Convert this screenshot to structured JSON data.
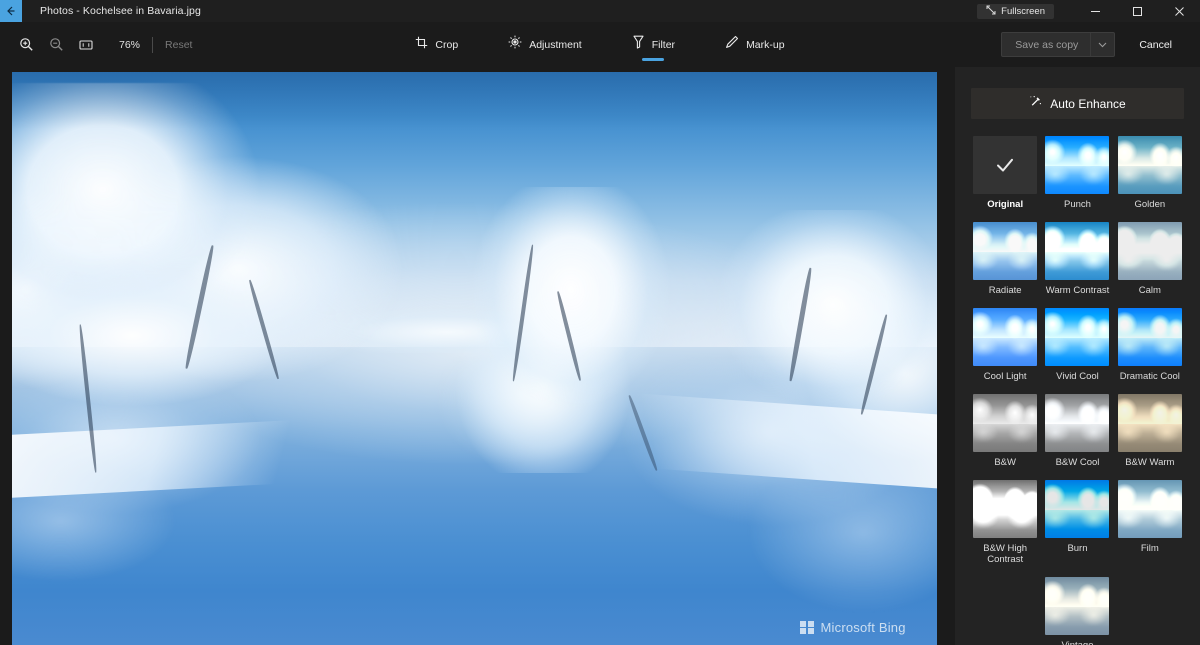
{
  "titlebar": {
    "back_icon": "back-arrow-icon",
    "title": "Photos - Kochelsee in Bavaria.jpg",
    "fullscreen_label": "Fullscreen",
    "fullscreen_icon": "expand-icon",
    "minimize_icon": "minimize-icon",
    "maximize_icon": "maximize-icon",
    "close_icon": "close-icon"
  },
  "toolbar": {
    "zoom_in_icon": "zoom-in-icon",
    "zoom_out_icon": "zoom-out-icon",
    "fit_to_window_icon": "fit-to-window-icon",
    "zoom_level": "76%",
    "reset_label": "Reset",
    "tabs": [
      {
        "label": "Crop",
        "icon": "crop-icon",
        "active": false
      },
      {
        "label": "Adjustment",
        "icon": "brightness-icon",
        "active": false
      },
      {
        "label": "Filter",
        "icon": "filter-icon",
        "active": true
      },
      {
        "label": "Mark-up",
        "icon": "pen-icon",
        "active": false
      }
    ],
    "save_as_copy_label": "Save as copy",
    "save_chevron_icon": "chevron-down-icon",
    "cancel_label": "Cancel"
  },
  "canvas": {
    "watermark_text": "Microsoft Bing",
    "watermark_logo": "microsoft-logo-icon"
  },
  "panel": {
    "auto_enhance_label": "Auto Enhance",
    "auto_enhance_icon": "magic-wand-icon",
    "selected_filter": "Original",
    "filters": [
      {
        "label": "Original",
        "fx": "original",
        "selected": true
      },
      {
        "label": "Punch",
        "fx": "fx-punch",
        "selected": false
      },
      {
        "label": "Golden",
        "fx": "fx-golden",
        "selected": false
      },
      {
        "label": "Radiate",
        "fx": "fx-radiate",
        "selected": false
      },
      {
        "label": "Warm Contrast",
        "fx": "fx-warmcon",
        "selected": false
      },
      {
        "label": "Calm",
        "fx": "fx-calm",
        "selected": false
      },
      {
        "label": "Cool Light",
        "fx": "fx-coollt",
        "selected": false
      },
      {
        "label": "Vivid Cool",
        "fx": "fx-vivid",
        "selected": false
      },
      {
        "label": "Dramatic Cool",
        "fx": "fx-dramcool",
        "selected": false
      },
      {
        "label": "B&W",
        "fx": "fx-bw",
        "selected": false
      },
      {
        "label": "B&W Cool",
        "fx": "fx-bwcool",
        "selected": false
      },
      {
        "label": "B&W Warm",
        "fx": "fx-bwwarm",
        "selected": false
      },
      {
        "label": "B&W High Contrast",
        "fx": "fx-bwhigh",
        "selected": false
      },
      {
        "label": "Burn",
        "fx": "fx-burn",
        "selected": false
      },
      {
        "label": "Film",
        "fx": "fx-film",
        "selected": false
      },
      {
        "label": "Vintage",
        "fx": "fx-vintage",
        "selected": false,
        "offset": 1
      }
    ]
  },
  "colors": {
    "accent": "#4aa3e0",
    "titlebar_bg": "#1f1f1f",
    "toolbar_bg": "#1b1b1b",
    "panel_bg": "#232323"
  }
}
